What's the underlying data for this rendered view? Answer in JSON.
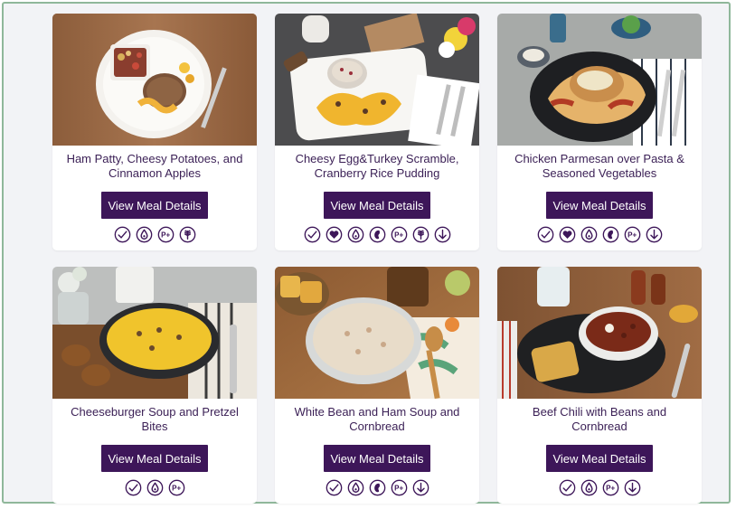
{
  "button_label": "View Meal Details",
  "brand_color": "#3d1659",
  "meals": [
    {
      "title_line1": "Ham Patty, Cheesy Potatoes, and",
      "title_line2": "Cinnamon Apples",
      "icons": [
        "check-icon",
        "diabetic-drop-icon",
        "protein-plus-icon",
        "grain-free-icon"
      ]
    },
    {
      "title_line1": "Cheesy Egg&Turkey Scramble,",
      "title_line2": "Cranberry Rice Pudding",
      "icons": [
        "check-icon",
        "heart-icon",
        "diabetic-drop-icon",
        "kidney-icon",
        "protein-plus-icon",
        "grain-free-icon",
        "low-sodium-icon"
      ]
    },
    {
      "title_line1": "Chicken Parmesan over Pasta &",
      "title_line2": "Seasoned Vegetables",
      "icons": [
        "check-icon",
        "heart-icon",
        "diabetic-drop-icon",
        "kidney-icon",
        "protein-plus-icon",
        "low-sodium-icon"
      ]
    },
    {
      "title_line1": "Cheeseburger Soup and Pretzel",
      "title_line2": "Bites",
      "icons": [
        "check-icon",
        "diabetic-drop-icon",
        "protein-plus-icon"
      ]
    },
    {
      "title_line1": "White Bean and Ham Soup and",
      "title_line2": "Cornbread",
      "icons": [
        "check-icon",
        "diabetic-drop-icon",
        "kidney-icon",
        "protein-plus-icon",
        "low-sodium-icon"
      ]
    },
    {
      "title_line1": "Beef Chili with Beans and",
      "title_line2": "Cornbread",
      "icons": [
        "check-icon",
        "diabetic-drop-icon",
        "protein-plus-icon",
        "low-sodium-icon"
      ]
    }
  ],
  "icon_label_text": {
    "protein_plus": "P+"
  }
}
